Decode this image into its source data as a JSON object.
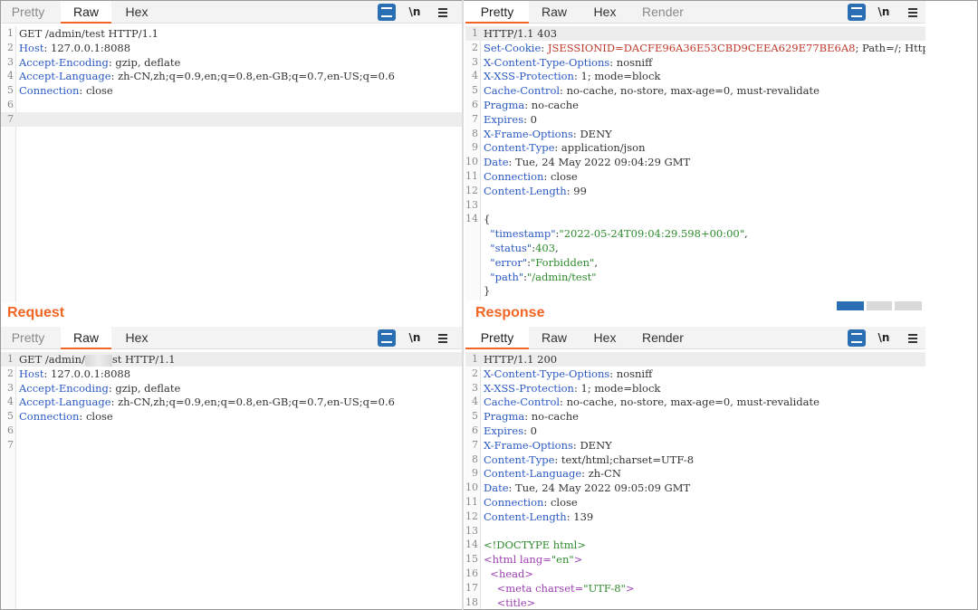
{
  "top_request": {
    "tabs": [
      "Pretty",
      "Raw",
      "Hex"
    ],
    "active_tab": "Raw",
    "lines": [
      {
        "n": "1",
        "k": "",
        "v": "GET /admin/test HTTP/1.1"
      },
      {
        "n": "2",
        "k": "Host",
        "v": ": 127.0.0.1:8088"
      },
      {
        "n": "3",
        "k": "Accept-Encoding",
        "v": ": gzip, deflate"
      },
      {
        "n": "4",
        "k": "Accept-Language",
        "v": ": zh-CN,zh;q=0.9,en;q=0.8,en-GB;q=0.7,en-US;q=0.6"
      },
      {
        "n": "5",
        "k": "Connection",
        "v": ": close"
      },
      {
        "n": "6",
        "k": "",
        "v": ""
      },
      {
        "n": "7",
        "k": "",
        "v": ""
      }
    ]
  },
  "top_response": {
    "tabs": [
      "Pretty",
      "Raw",
      "Hex",
      "Render"
    ],
    "active_tab": "Pretty",
    "lines": [
      {
        "n": "1",
        "k": "",
        "v": "HTTP/1.1 403"
      },
      {
        "n": "2",
        "k": "Set-Cookie",
        "v": ": ",
        "r": "JSESSIONID=DACFE96A36E53CBD9CEEA629E77BE6A8",
        "t": "; Path=/; HttpOnly"
      },
      {
        "n": "3",
        "k": "X-Content-Type-Options",
        "v": ": nosniff"
      },
      {
        "n": "4",
        "k": "X-XSS-Protection",
        "v": ": 1; mode=block"
      },
      {
        "n": "5",
        "k": "Cache-Control",
        "v": ": no-cache, no-store, max-age=0, must-revalidate"
      },
      {
        "n": "6",
        "k": "Pragma",
        "v": ": no-cache"
      },
      {
        "n": "7",
        "k": "Expires",
        "v": ": 0"
      },
      {
        "n": "8",
        "k": "X-Frame-Options",
        "v": ": DENY"
      },
      {
        "n": "9",
        "k": "Content-Type",
        "v": ": application/json"
      },
      {
        "n": "10",
        "k": "Date",
        "v": ": Tue, 24 May 2022 09:04:29 GMT"
      },
      {
        "n": "11",
        "k": "Connection",
        "v": ": close"
      },
      {
        "n": "12",
        "k": "Content-Length",
        "v": ": 99"
      },
      {
        "n": "13",
        "k": "",
        "v": ""
      },
      {
        "n": "14",
        "k": "",
        "v": "{"
      },
      {
        "n": "",
        "k": "  \"timestamp\"",
        "v": ":",
        "g": "\"2022-05-24T09:04:29.598+00:00\"",
        "t": ","
      },
      {
        "n": "",
        "k": "  \"status\"",
        "v": ":",
        "g": "403",
        "t": ","
      },
      {
        "n": "",
        "k": "  \"error\"",
        "v": ":",
        "g": "\"Forbidden\"",
        "t": ","
      },
      {
        "n": "",
        "k": "  \"path\"",
        "v": ":",
        "g": "\"/admin/test\"",
        "t": ""
      },
      {
        "n": "",
        "k": "",
        "v": "}"
      }
    ]
  },
  "labels": {
    "request": "Request",
    "response": "Response"
  },
  "bottom_request": {
    "tabs": [
      "Pretty",
      "Raw",
      "Hex"
    ],
    "active_tab": "Raw",
    "lines": [
      {
        "n": "1",
        "k": "",
        "v": "GET /admin/",
        "redact": true,
        "t": "st HTTP/1.1"
      },
      {
        "n": "2",
        "k": "Host",
        "v": ": 127.0.0.1:8088"
      },
      {
        "n": "3",
        "k": "Accept-Encoding",
        "v": ": gzip, deflate"
      },
      {
        "n": "4",
        "k": "Accept-Language",
        "v": ": zh-CN,zh;q=0.9,en;q=0.8,en-GB;q=0.7,en-US;q=0.6"
      },
      {
        "n": "5",
        "k": "Connection",
        "v": ": close"
      },
      {
        "n": "6",
        "k": "",
        "v": ""
      },
      {
        "n": "7",
        "k": "",
        "v": ""
      }
    ]
  },
  "bottom_response": {
    "tabs": [
      "Pretty",
      "Raw",
      "Hex",
      "Render"
    ],
    "active_tab": "Pretty",
    "lines": [
      {
        "n": "1",
        "k": "",
        "v": "HTTP/1.1 200"
      },
      {
        "n": "2",
        "k": "X-Content-Type-Options",
        "v": ": nosniff"
      },
      {
        "n": "3",
        "k": "X-XSS-Protection",
        "v": ": 1; mode=block"
      },
      {
        "n": "4",
        "k": "Cache-Control",
        "v": ": no-cache, no-store, max-age=0, must-revalidate"
      },
      {
        "n": "5",
        "k": "Pragma",
        "v": ": no-cache"
      },
      {
        "n": "6",
        "k": "Expires",
        "v": ": 0"
      },
      {
        "n": "7",
        "k": "X-Frame-Options",
        "v": ": DENY"
      },
      {
        "n": "8",
        "k": "Content-Type",
        "v": ": text/html;charset=UTF-8"
      },
      {
        "n": "9",
        "k": "Content-Language",
        "v": ": zh-CN"
      },
      {
        "n": "10",
        "k": "Date",
        "v": ": Tue, 24 May 2022 09:05:09 GMT"
      },
      {
        "n": "11",
        "k": "Connection",
        "v": ": close"
      },
      {
        "n": "12",
        "k": "Content-Length",
        "v": ": 139"
      },
      {
        "n": "13",
        "k": "",
        "v": ""
      },
      {
        "n": "14",
        "k": "",
        "v": "",
        "g": "<!DOCTYPE html>"
      },
      {
        "n": "15",
        "k": "",
        "v": "",
        "p": "<html lang=",
        "g": "\"en\"",
        "p2": ">"
      },
      {
        "n": "16",
        "k": "",
        "v": "",
        "p": "  <head>"
      },
      {
        "n": "17",
        "k": "",
        "v": "",
        "p": "    <meta charset=",
        "g": "\"UTF-8\"",
        "p2": ">"
      },
      {
        "n": "18",
        "k": "",
        "v": "",
        "p": "    <title>"
      }
    ]
  },
  "toolbar": {
    "newline_label": "\\n"
  }
}
